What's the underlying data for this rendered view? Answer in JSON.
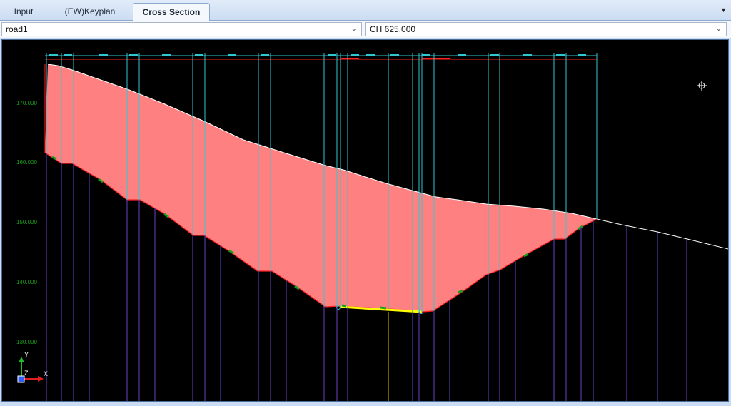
{
  "tabs": [
    {
      "label": "Input",
      "active": false
    },
    {
      "label": "(EW)Keyplan",
      "active": false
    },
    {
      "label": "Cross Section",
      "active": true
    }
  ],
  "toolbar": {
    "road_select": "road1",
    "chainage_select": "CH 625.000"
  },
  "section": {
    "elevation_labels": [
      "170.000",
      "160.000",
      "150.000",
      "140.000",
      "130.000"
    ],
    "axis_labels": {
      "y": "Y",
      "z": "Z",
      "x": "X"
    }
  },
  "colors": {
    "fill": "#ff8080",
    "excavation_line": "#ff2020",
    "vertical_line": "#30c8d0",
    "pile_line": "#6a3fc8",
    "elevation_text": "#1aa01a",
    "ground": "#ffffff",
    "bottom": "#ffff00"
  }
}
